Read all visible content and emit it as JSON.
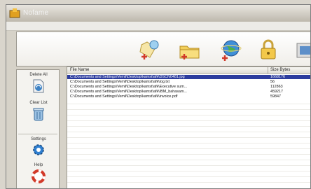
{
  "window": {
    "title": "Nofame"
  },
  "toolbar": {
    "buttons": [
      {
        "icon": "add-file-icon"
      },
      {
        "icon": "add-folder-icon"
      },
      {
        "icon": "globe-icon"
      },
      {
        "icon": "lock-icon"
      },
      {
        "icon": "shield-icon"
      }
    ]
  },
  "sidebar": {
    "delete_all_label": "Delete All",
    "clear_list_label": "Clear List",
    "settings_label": "Settings",
    "help_label": "Help"
  },
  "file_list": {
    "columns": [
      "File Name",
      "Size Bytes"
    ],
    "rows": [
      {
        "path": "C:\\Documents and Settings\\Vemil\\Desktop\\kamst\\afk\\DSCN0481.jpg",
        "size": "1668176",
        "selected": true
      },
      {
        "path": "C:\\Documents and Settings\\Vemil\\Desktop\\kamst\\afk\\log.txt",
        "size": "56",
        "selected": false
      },
      {
        "path": "C:\\Documents and Settings\\Vemil\\Desktop\\kamst\\afk\\Executive sum...",
        "size": "112863",
        "selected": false
      },
      {
        "path": "C:\\Documents and Settings\\Vemil\\Desktop\\kamst\\afk\\IBM_bahasam...",
        "size": "459217",
        "selected": false
      },
      {
        "path": "C:\\Documents and Settings\\Vemil\\Desktop\\kamst\\afk\\invoice.pdf",
        "size": "59847",
        "selected": false
      }
    ]
  }
}
